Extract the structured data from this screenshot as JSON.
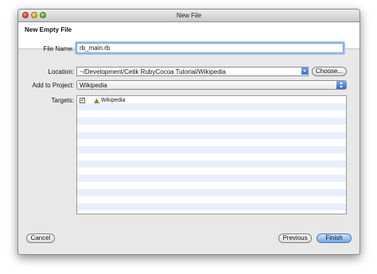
{
  "window": {
    "title": "New File"
  },
  "header": {
    "title": "New Empty File"
  },
  "form": {
    "file_name_label": "File Name:",
    "file_name_value": "rb_main.rb",
    "location_label": "Location:",
    "location_value": "~/Development/Cetik RubyCocoa Tutorial/Wikipedia",
    "choose_label": "Choose...",
    "add_to_project_label": "Add to Project:",
    "add_to_project_value": "Wikipedia",
    "targets_label": "Targets:",
    "targets": [
      {
        "checked": true,
        "name": "Wikipedia",
        "icon": "target-icon"
      }
    ]
  },
  "footer": {
    "cancel_label": "Cancel",
    "previous_label": "Previous",
    "finish_label": "Finish"
  }
}
